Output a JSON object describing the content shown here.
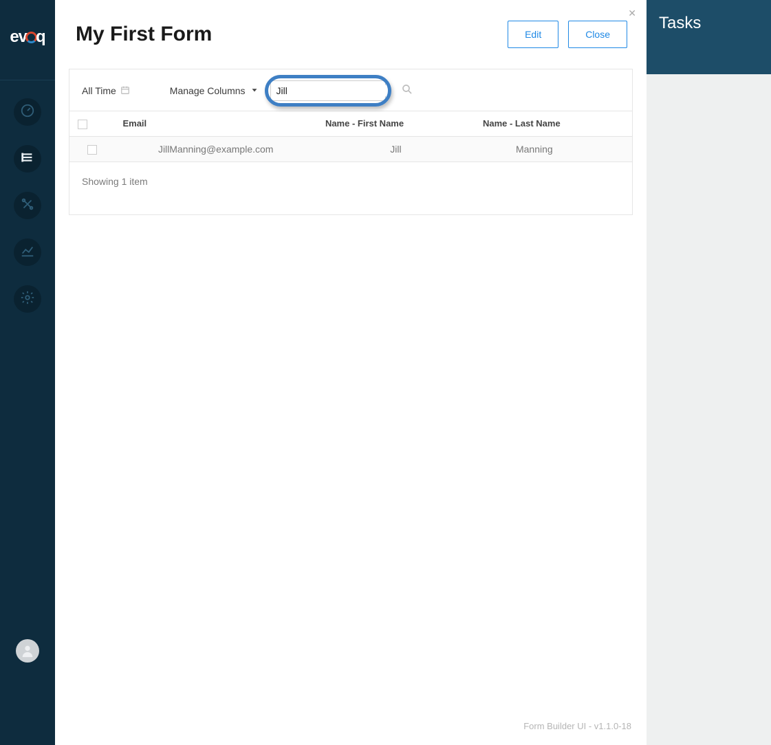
{
  "brand": "evoq",
  "header": {
    "title": "My First Form",
    "edit": "Edit",
    "close": "Close"
  },
  "toolbar": {
    "time_filter": "All Time",
    "manage_columns": "Manage Columns",
    "search_value": "Jill"
  },
  "table": {
    "columns": {
      "email": "Email",
      "first": "Name - First Name",
      "last": "Name - Last Name"
    },
    "rows": [
      {
        "email": "JillManning@example.com",
        "first": "Jill",
        "last": "Manning"
      }
    ]
  },
  "status": "Showing 1 item",
  "footer_version": "Form Builder UI - v1.1.0-18",
  "right": {
    "title": "Tasks"
  }
}
